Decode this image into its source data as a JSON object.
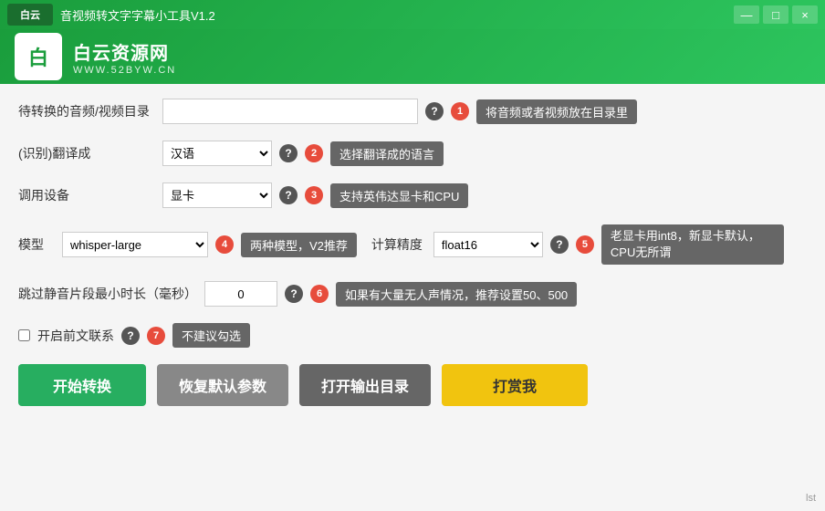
{
  "app": {
    "title": "音视频转文字字幕小工具V1.2",
    "version": "V1.2"
  },
  "banner": {
    "site_name": "白云资源网",
    "site_url": "WWW.52BYW.CN",
    "logo_char": "白"
  },
  "window_buttons": {
    "minimize": "—",
    "maximize": "□",
    "close": "×"
  },
  "form": {
    "dir_label": "待转换的音频/视频目录",
    "dir_placeholder": "",
    "dir_tip": "将音频或者视频放在目录里",
    "lang_label": "(识别)翻译成",
    "lang_value": "汉语",
    "lang_tip": "选择翻译成的语言",
    "device_label": "调用设备",
    "device_value": "显卡",
    "device_tip": "支持英伟达显卡和CPU",
    "model_label": "模型",
    "model_value": "whisper-larg",
    "model_tip_badge": "两种模型，V2推荐",
    "precision_label": "计算精度",
    "precision_value": "float16",
    "precision_tip": "老显卡用int8，新显卡默认，CPU无所谓",
    "skip_label": "跳过静音片段最小时长（毫秒）",
    "skip_value": "0",
    "skip_tip": "如果有大量无人声情况，推荐设置50、500",
    "context_label": "开启前文联系",
    "context_tip": "不建议勾选",
    "context_checked": false
  },
  "buttons": {
    "start": "开始转换",
    "reset": "恢复默认参数",
    "open_dir": "打开输出目录",
    "donate": "打赏我"
  },
  "steps": {
    "s1": "1",
    "s2": "2",
    "s3": "3",
    "s4": "4",
    "s5": "5",
    "s6": "6",
    "s7": "7"
  },
  "bottom": {
    "text": "lst"
  }
}
